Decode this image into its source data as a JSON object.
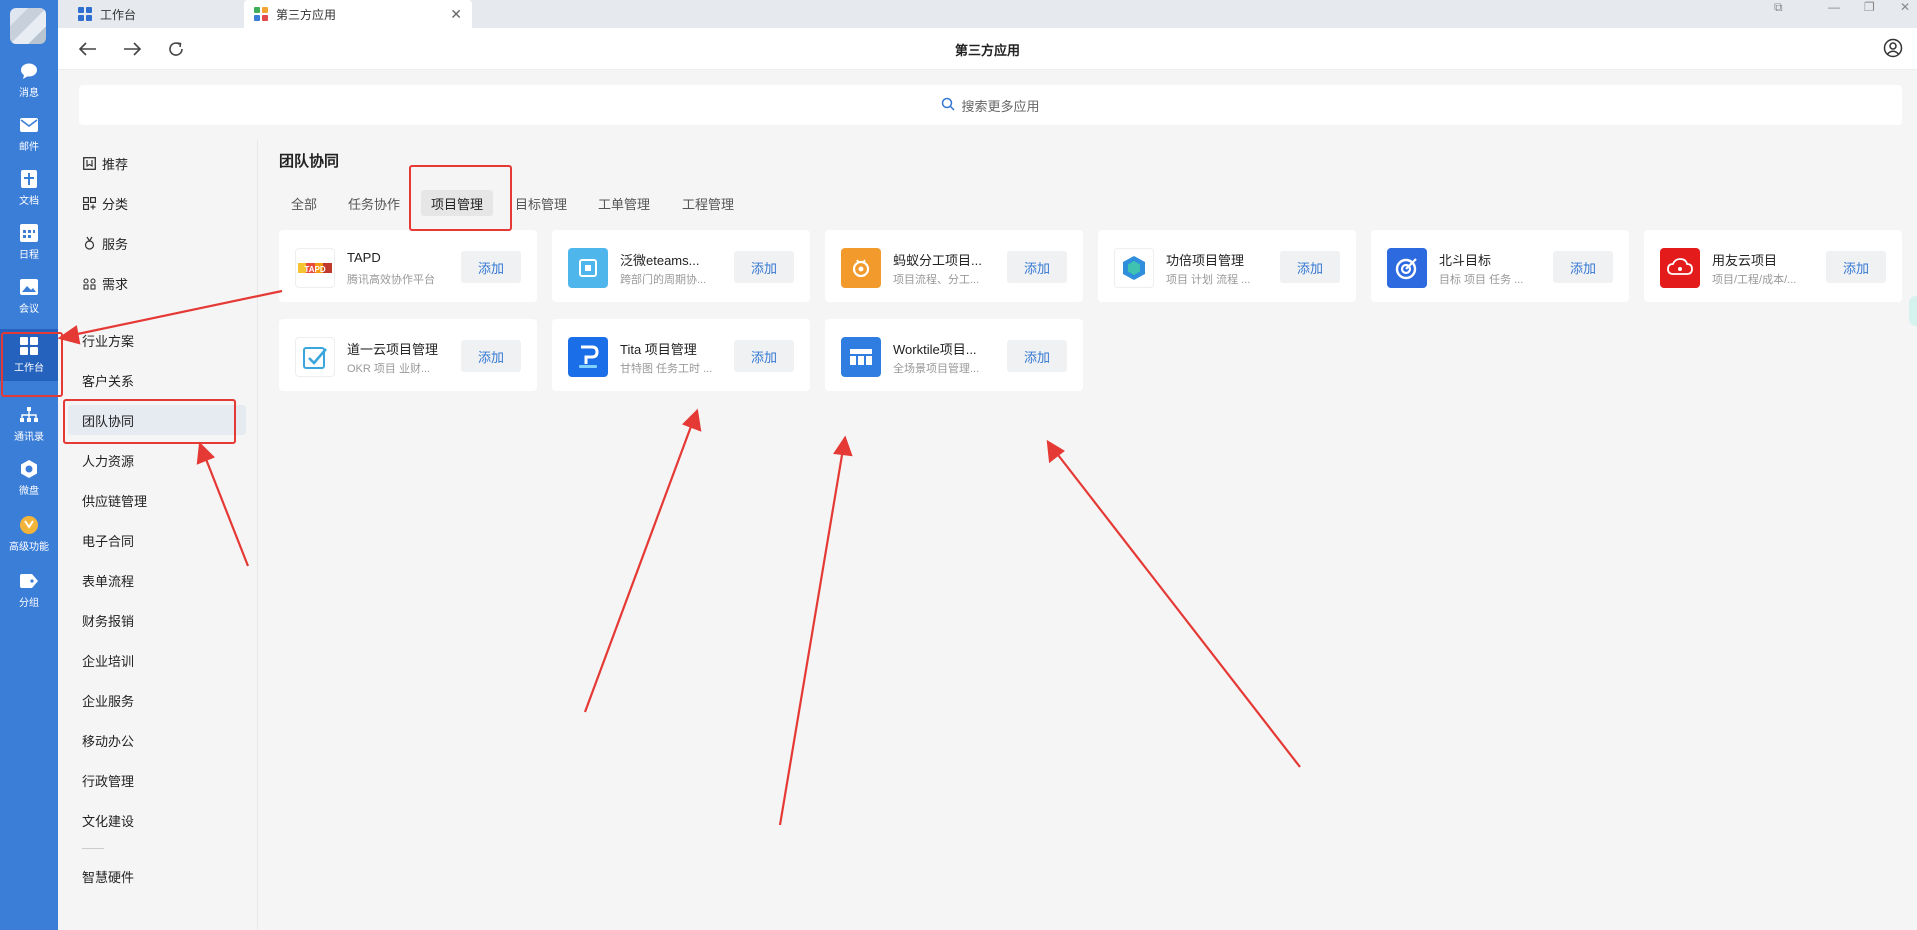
{
  "tabs": [
    {
      "label": "工作台"
    },
    {
      "label": "第三方应用"
    }
  ],
  "toolbar": {
    "title": "第三方应用"
  },
  "search": {
    "placeholder": "搜索更多应用"
  },
  "rail": [
    {
      "label": "消息",
      "icon": "chat-icon"
    },
    {
      "label": "邮件",
      "icon": "mail-icon"
    },
    {
      "label": "文档",
      "icon": "doc-icon"
    },
    {
      "label": "日程",
      "icon": "calendar-icon"
    },
    {
      "label": "会议",
      "icon": "meeting-icon"
    },
    {
      "label": "工作台",
      "icon": "grid-icon"
    },
    {
      "label": "通讯录",
      "icon": "contacts-icon"
    },
    {
      "label": "微盘",
      "icon": "drive-icon"
    },
    {
      "label": "高级功能",
      "icon": "advanced-icon"
    },
    {
      "label": "分组",
      "icon": "tag-icon"
    }
  ],
  "menu": {
    "top": [
      {
        "label": "推荐",
        "icon": "bookmark-icon"
      },
      {
        "label": "分类",
        "icon": "category-icon"
      },
      {
        "label": "服务",
        "icon": "service-icon"
      },
      {
        "label": "需求",
        "icon": "demand-icon"
      }
    ],
    "categories": [
      "行业方案",
      "客户关系",
      "团队协同",
      "人力资源",
      "供应链管理",
      "电子合同",
      "表单流程",
      "财务报销",
      "企业培训",
      "企业服务",
      "移动办公",
      "行政管理",
      "文化建设"
    ],
    "bottom": "智慧硬件"
  },
  "section": {
    "title": "团队协同",
    "tabs": [
      "全部",
      "任务协作",
      "项目管理",
      "目标管理",
      "工单管理",
      "工程管理"
    ]
  },
  "apps": [
    {
      "name": "TAPD",
      "desc": "腾讯高效协作平台",
      "add": "添加"
    },
    {
      "name": "泛微eteams...",
      "desc": "跨部门的周期协...",
      "add": "添加"
    },
    {
      "name": "蚂蚁分工项目...",
      "desc": "项目流程、分工...",
      "add": "添加"
    },
    {
      "name": "功倍项目管理",
      "desc": "项目 计划 流程 ...",
      "add": "添加"
    },
    {
      "name": "北斗目标",
      "desc": "目标 项目 任务 ...",
      "add": "添加"
    },
    {
      "name": "用友云项目",
      "desc": "项目/工程/成本/...",
      "add": "添加"
    },
    {
      "name": "道一云项目管理",
      "desc": "OKR 项目 业财...",
      "add": "添加"
    },
    {
      "name": "Tita 项目管理",
      "desc": "甘特图 任务工时 ...",
      "add": "添加"
    },
    {
      "name": "Worktile项目...",
      "desc": "全场景项目管理...",
      "add": "添加"
    }
  ],
  "colors": {
    "rail": "#3b7ed8",
    "accent": "#3478d3",
    "annotation": "#e53935"
  }
}
